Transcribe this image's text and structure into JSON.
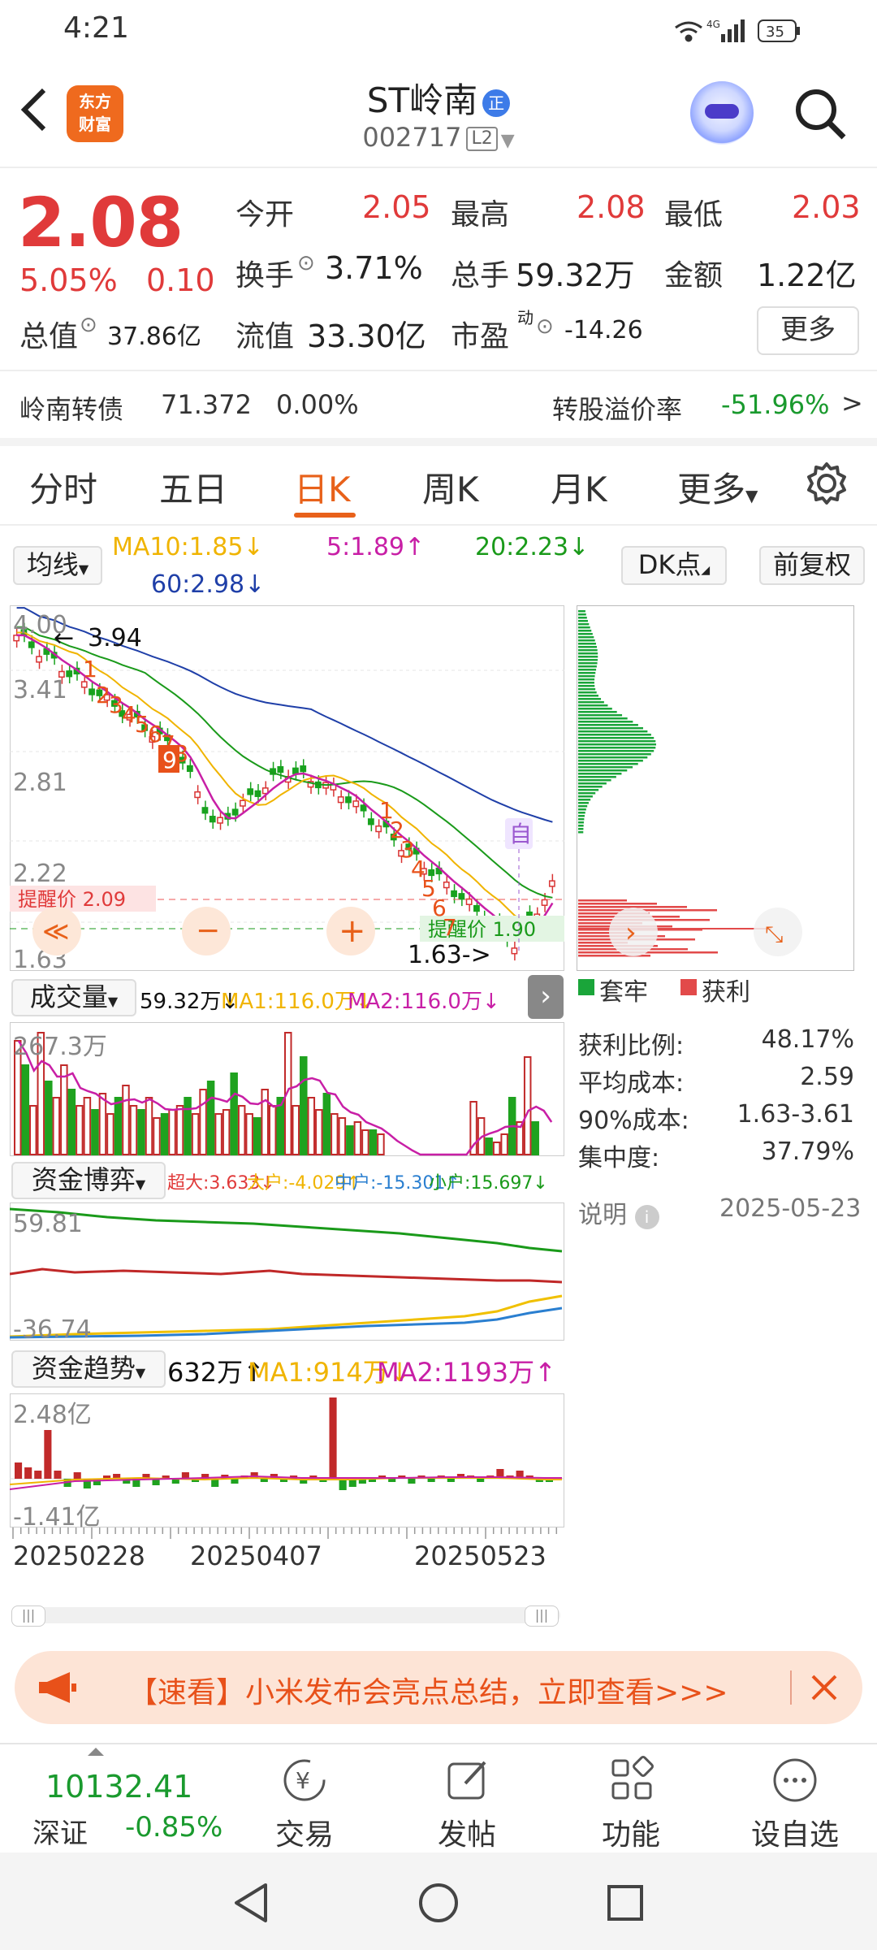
{
  "status_bar": {
    "time": "4:21",
    "network": "4G",
    "battery": "35"
  },
  "header": {
    "logo_line1": "东方",
    "logo_line2": "财富",
    "title": "ST岭南",
    "title_badge": "正",
    "code": "002717",
    "level": "L2"
  },
  "quote": {
    "price": "2.08",
    "change_pct": "5.05%",
    "change": "0.10",
    "open_label": "今开",
    "open": "2.05",
    "high_label": "最高",
    "high": "2.08",
    "low_label": "最低",
    "low": "2.03",
    "turnover_label": "换手",
    "turnover": "3.71%",
    "volume_label": "总手",
    "volume": "59.32万",
    "amount_label": "金额",
    "amount": "1.22亿",
    "mktcap_label": "总值",
    "mktcap": "37.86亿",
    "float_label": "流值",
    "float_cap": "33.30亿",
    "pe_label": "市盈",
    "pe_sup": "动",
    "pe": "-14.26",
    "more_btn": "更多"
  },
  "bond": {
    "label": "岭南转债",
    "price": "71.372",
    "pct": "0.00%",
    "premium_label": "转股溢价率",
    "premium": "-51.96%",
    "arrow": ">"
  },
  "tabs": [
    "分时",
    "五日",
    "日K",
    "周K",
    "月K",
    "更多"
  ],
  "chart_controls": {
    "ma_select": "均线",
    "ma10": "MA10:1.85↓",
    "ma5": "5:1.89↑",
    "ma20": "20:2.23↓",
    "ma60": "60:2.98↓",
    "dk_btn": "DK点",
    "fq_btn": "前复权"
  },
  "kline": {
    "y_labels": [
      "4.00",
      "3.41",
      "2.81",
      "2.22",
      "1.63"
    ],
    "high_marker": "3.94",
    "low_marker": "1.63->",
    "alert_left": "提醒价 2.09",
    "alert_right": "提醒价 1.90",
    "self_mark": "自",
    "nums_a": [
      "1",
      "2",
      "3",
      "4",
      "5",
      "6",
      "7",
      "8"
    ],
    "num_9": "9",
    "nums_b": [
      "1",
      "2",
      "3",
      "4",
      "5",
      "6",
      "7"
    ],
    "colors": {
      "up": "#d93434",
      "down": "#18a21e",
      "ma5": "#c81fa6",
      "ma10": "#f0b400",
      "ma20": "#1a9a1a",
      "ma60": "#1f3fa8"
    }
  },
  "chart_data": {
    "type": "bar",
    "title": "成交量",
    "series": [
      {
        "name": "成交量",
        "current": "59.32万"
      },
      {
        "name": "MA1",
        "current": "116.0万"
      },
      {
        "name": "MA2",
        "current": "116.0万"
      }
    ],
    "ymax_label": "267.3万",
    "x_labels": [
      "20250228",
      "20250407",
      "20250523"
    ]
  },
  "volume_panel": {
    "select": "成交量",
    "vol": "59.32万↓",
    "ma1": "MA1:116.0万↓",
    "ma2": "MA2:116.0万↓",
    "ymax": "267.3万"
  },
  "fund_game": {
    "select": "资金博弈",
    "super": "超大:3.633↓",
    "big": "大户:-4.029↑",
    "mid": "中户:-15.301↑",
    "small": "小户:15.697↓",
    "ymax": "59.81",
    "ymin": "-36.74"
  },
  "fund_trend": {
    "select": "资金趋势",
    "val": "632万↑",
    "ma1": "MA1:914万↓",
    "ma2": "MA2:1193万↑",
    "ymax": "2.48亿",
    "ymin": "-1.41亿"
  },
  "x_dates": [
    "20250228",
    "20250407",
    "20250523"
  ],
  "chip_panel": {
    "legend_trap": "套牢",
    "legend_profit": "获利",
    "stats": [
      {
        "label": "获利比例:",
        "value": "48.17%"
      },
      {
        "label": "平均成本:",
        "value": "2.59"
      },
      {
        "label": "90%成本:",
        "value": "1.63-3.61"
      },
      {
        "label": "集中度:",
        "value": "37.79%"
      }
    ],
    "note": "说明",
    "date": "2025-05-23"
  },
  "banner": {
    "text": "【速看】小米发布会亮点总结，立即查看>>>"
  },
  "bottom_bar": {
    "index_value": "10132.41",
    "index_name": "深证",
    "index_pct": "-0.85%",
    "items": [
      "交易",
      "发帖",
      "功能",
      "设自选"
    ]
  }
}
